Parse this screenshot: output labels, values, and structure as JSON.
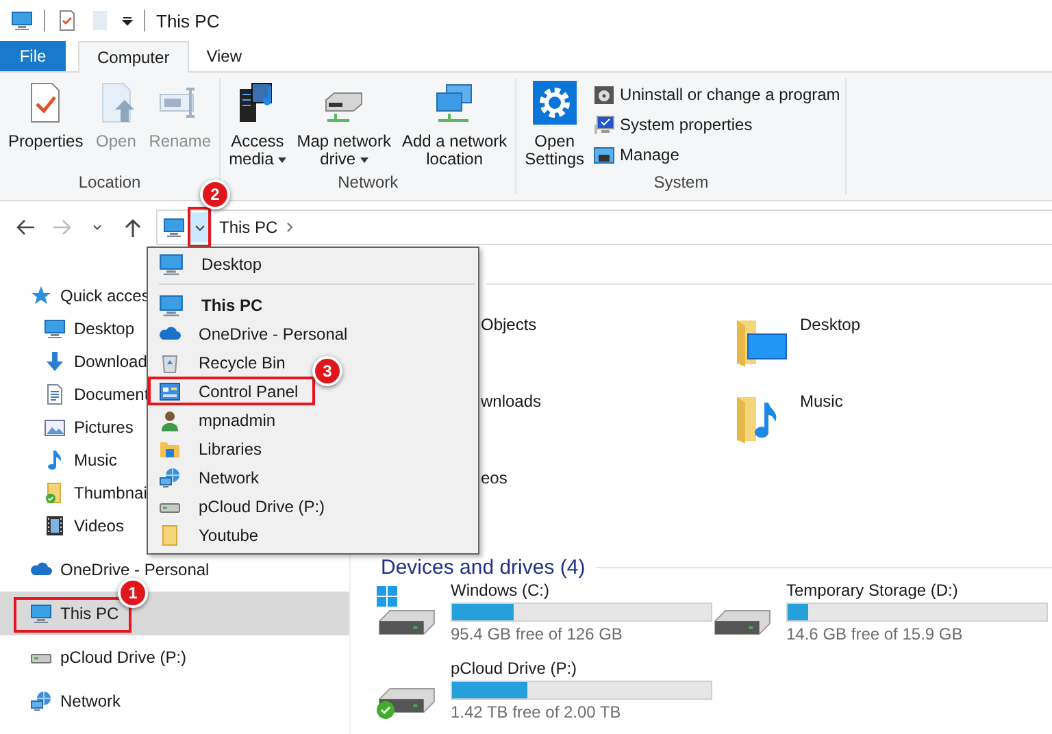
{
  "title_bar": {
    "title": "This PC"
  },
  "ribbon_tabs": [
    {
      "label": "File",
      "kind": "file",
      "selected": false
    },
    {
      "label": "Computer",
      "kind": "tab",
      "selected": true
    },
    {
      "label": "View",
      "kind": "tab",
      "selected": false
    }
  ],
  "ribbon_groups": [
    {
      "label": "Location",
      "commands": [
        {
          "label": "Properties",
          "disabled": false,
          "has_menu": false
        },
        {
          "label": "Open",
          "disabled": true,
          "has_menu": false
        },
        {
          "label": "Rename",
          "disabled": true,
          "has_menu": false
        }
      ]
    },
    {
      "label": "Network",
      "commands": [
        {
          "label": "Access\nmedia",
          "disabled": false,
          "has_menu": true
        },
        {
          "label": "Map network\ndrive",
          "disabled": false,
          "has_menu": true
        },
        {
          "label": "Add a network\nlocation",
          "disabled": false,
          "has_menu": false
        }
      ]
    },
    {
      "label": "System",
      "commands": [
        {
          "label": "Open\nSettings",
          "disabled": false,
          "has_menu": false
        }
      ],
      "small_commands": [
        {
          "label": "Uninstall or change a program"
        },
        {
          "label": "System properties"
        },
        {
          "label": "Manage"
        }
      ]
    }
  ],
  "nav_buttons": [
    {
      "kind": "back",
      "disabled": false
    },
    {
      "kind": "forward",
      "disabled": true
    },
    {
      "kind": "recent",
      "disabled": false
    },
    {
      "kind": "up",
      "disabled": false
    }
  ],
  "address_bar": {
    "location": "This PC",
    "dropdown_open": true,
    "callout": "2"
  },
  "location_menu": [
    {
      "kind": "item",
      "label": "Desktop",
      "current": false
    },
    {
      "kind": "separator"
    },
    {
      "kind": "item",
      "label": "This PC",
      "current": true
    },
    {
      "kind": "item",
      "label": "OneDrive - Personal",
      "current": false
    },
    {
      "kind": "item",
      "label": "Recycle Bin",
      "current": false
    },
    {
      "kind": "item",
      "label": "Control Panel",
      "current": false,
      "callout": "3"
    },
    {
      "kind": "item",
      "label": "mpnadmin",
      "current": false
    },
    {
      "kind": "item",
      "label": "Libraries",
      "current": false
    },
    {
      "kind": "item",
      "label": "Network",
      "current": false
    },
    {
      "kind": "item",
      "label": "pCloud Drive (P:)",
      "current": false
    },
    {
      "kind": "item",
      "label": "Youtube",
      "current": false
    }
  ],
  "navigation": [
    {
      "label": "Quick acces",
      "selected": false,
      "children": [
        {
          "label": "Desktop",
          "selected": false
        },
        {
          "label": "Download",
          "selected": false
        },
        {
          "label": "Document",
          "selected": false
        },
        {
          "label": "Pictures",
          "selected": false
        },
        {
          "label": "Music",
          "selected": false
        },
        {
          "label": "Thumbnai",
          "selected": false
        },
        {
          "label": "Videos",
          "selected": false
        }
      ]
    },
    {
      "label": "OneDrive - Personal",
      "selected": false
    },
    {
      "label": "This PC",
      "selected": true,
      "callout": "1"
    },
    {
      "label": "pCloud Drive (P:)",
      "selected": false
    },
    {
      "label": "Network",
      "selected": false
    }
  ],
  "folders": [
    {
      "label": "Objects",
      "kind": "partial"
    },
    {
      "label": "Desktop",
      "kind": "folder"
    },
    {
      "label": "wnloads",
      "kind": "partial"
    },
    {
      "label": "Music",
      "kind": "folder"
    },
    {
      "label": "eos",
      "kind": "partial"
    }
  ],
  "drives_header": "Devices and drives (4)",
  "drives": [
    {
      "name": "Windows (C:)",
      "level": 0.24,
      "free": "95.4 GB free of 126 GB"
    },
    {
      "name": "Temporary Storage (D:)",
      "level": 0.08,
      "free": "14.6 GB free of 15.9 GB"
    },
    {
      "name": "pCloud Drive (P:)",
      "level": 0.29,
      "free": "1.42 TB free of 2.00 TB"
    }
  ]
}
